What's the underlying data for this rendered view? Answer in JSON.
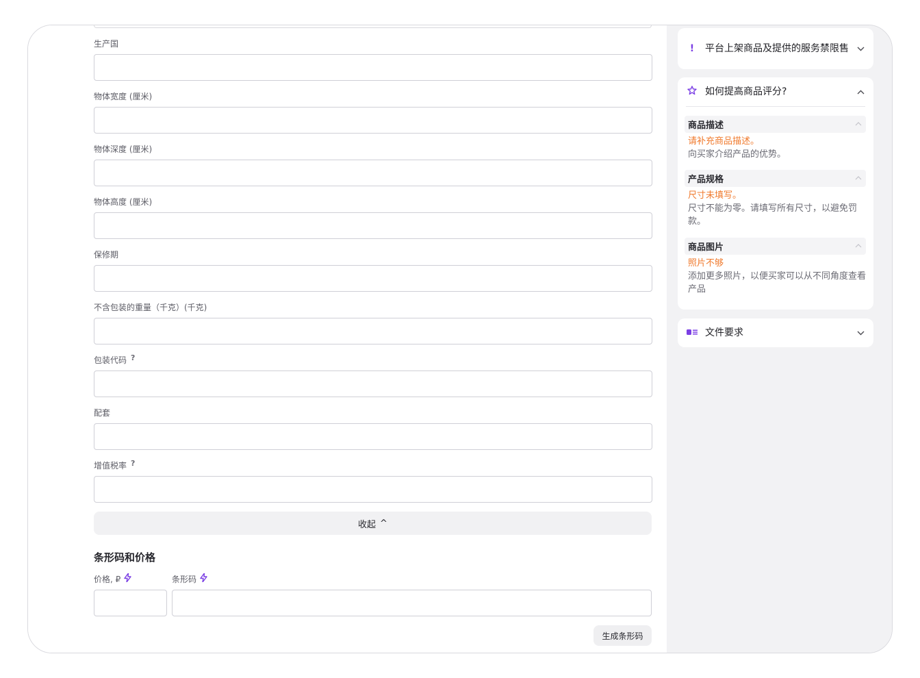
{
  "form": {
    "fields": [
      {
        "label": "生产国",
        "value": "",
        "help": ""
      },
      {
        "label": "物体宽度 (厘米)",
        "value": "",
        "help": ""
      },
      {
        "label": "物体深度 (厘米)",
        "value": "",
        "help": ""
      },
      {
        "label": "物体高度 (厘米)",
        "value": "",
        "help": ""
      },
      {
        "label": "保修期",
        "value": "",
        "help": ""
      },
      {
        "label": "不含包装的重量（千克）(千克)",
        "value": "",
        "help": ""
      },
      {
        "label": "包装代码",
        "value": "",
        "help": "?"
      },
      {
        "label": "配套",
        "value": "",
        "help": ""
      },
      {
        "label": "增值税率",
        "value": "",
        "help": "?"
      }
    ],
    "collapse_label": "收起",
    "collapse_chevron": "^",
    "section_title": "条形码和价格",
    "price_label": "价格, ₽",
    "barcode_label": "条形码",
    "generate_label": "生成条形码"
  },
  "sidebar": {
    "card1": {
      "title": "平台上架商品及提供的服务禁限售",
      "icon": "exclamation-icon"
    },
    "card2": {
      "title": "如何提高商品评分?",
      "icon": "star-icon",
      "tips": [
        {
          "heading": "商品描述",
          "warning": "请补充商品描述。",
          "description": "向买家介绍产品的优势。"
        },
        {
          "heading": "产品规格",
          "warning": "尺寸未填写。",
          "description": "尺寸不能为零。请填写所有尺寸，以避免罚款。"
        },
        {
          "heading": "商品图片",
          "warning": "照片不够",
          "description": "添加更多照片，以便买家可以从不同角度查看产品"
        }
      ]
    },
    "card3": {
      "title": "文件要求",
      "icon": "document-icon"
    }
  },
  "colors": {
    "accent": "#7b3fe4",
    "warning": "#f07a2d",
    "sidebar_bg": "#f2f2f4"
  }
}
